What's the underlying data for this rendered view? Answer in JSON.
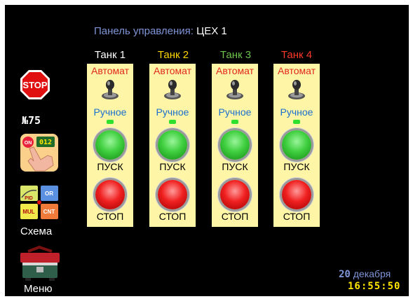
{
  "header": {
    "title_label": "Панель управления:",
    "title_value": "ЦЕХ 1"
  },
  "sidebar": {
    "stop_icon_text": "STOP",
    "controller_number": "№75",
    "onoff_icon_text": [
      "ON",
      "012"
    ],
    "scheme_tiles": [
      "PID",
      "OR",
      "MUL",
      "CNT"
    ],
    "scheme_label": "Схема",
    "menu_label": "Меню"
  },
  "tanks": [
    {
      "name": "Танк 1",
      "color": "#ffffff",
      "auto_label": "Автомат",
      "manual_label": "Ручное",
      "start_label": "ПУСК",
      "stop_label": "СТОП"
    },
    {
      "name": "Танк 2",
      "color": "#ffd700",
      "auto_label": "Автомат",
      "manual_label": "Ручное",
      "start_label": "ПУСК",
      "stop_label": "СТОП"
    },
    {
      "name": "Танк 3",
      "color": "#6cc24a",
      "auto_label": "Автомат",
      "manual_label": "Ручное",
      "start_label": "ПУСК",
      "stop_label": "СТОП"
    },
    {
      "name": "Танк 4",
      "color": "#ff3a2a",
      "auto_label": "Автомат",
      "manual_label": "Ручное",
      "start_label": "ПУСК",
      "stop_label": "СТОП"
    }
  ],
  "clock": {
    "day": "20",
    "month": "декабря",
    "time": "16:55:50"
  },
  "colors": {
    "background": "#000000",
    "panel": "#fff5a6",
    "accent": "#7f95d8",
    "led_green": "#2fe02f"
  }
}
